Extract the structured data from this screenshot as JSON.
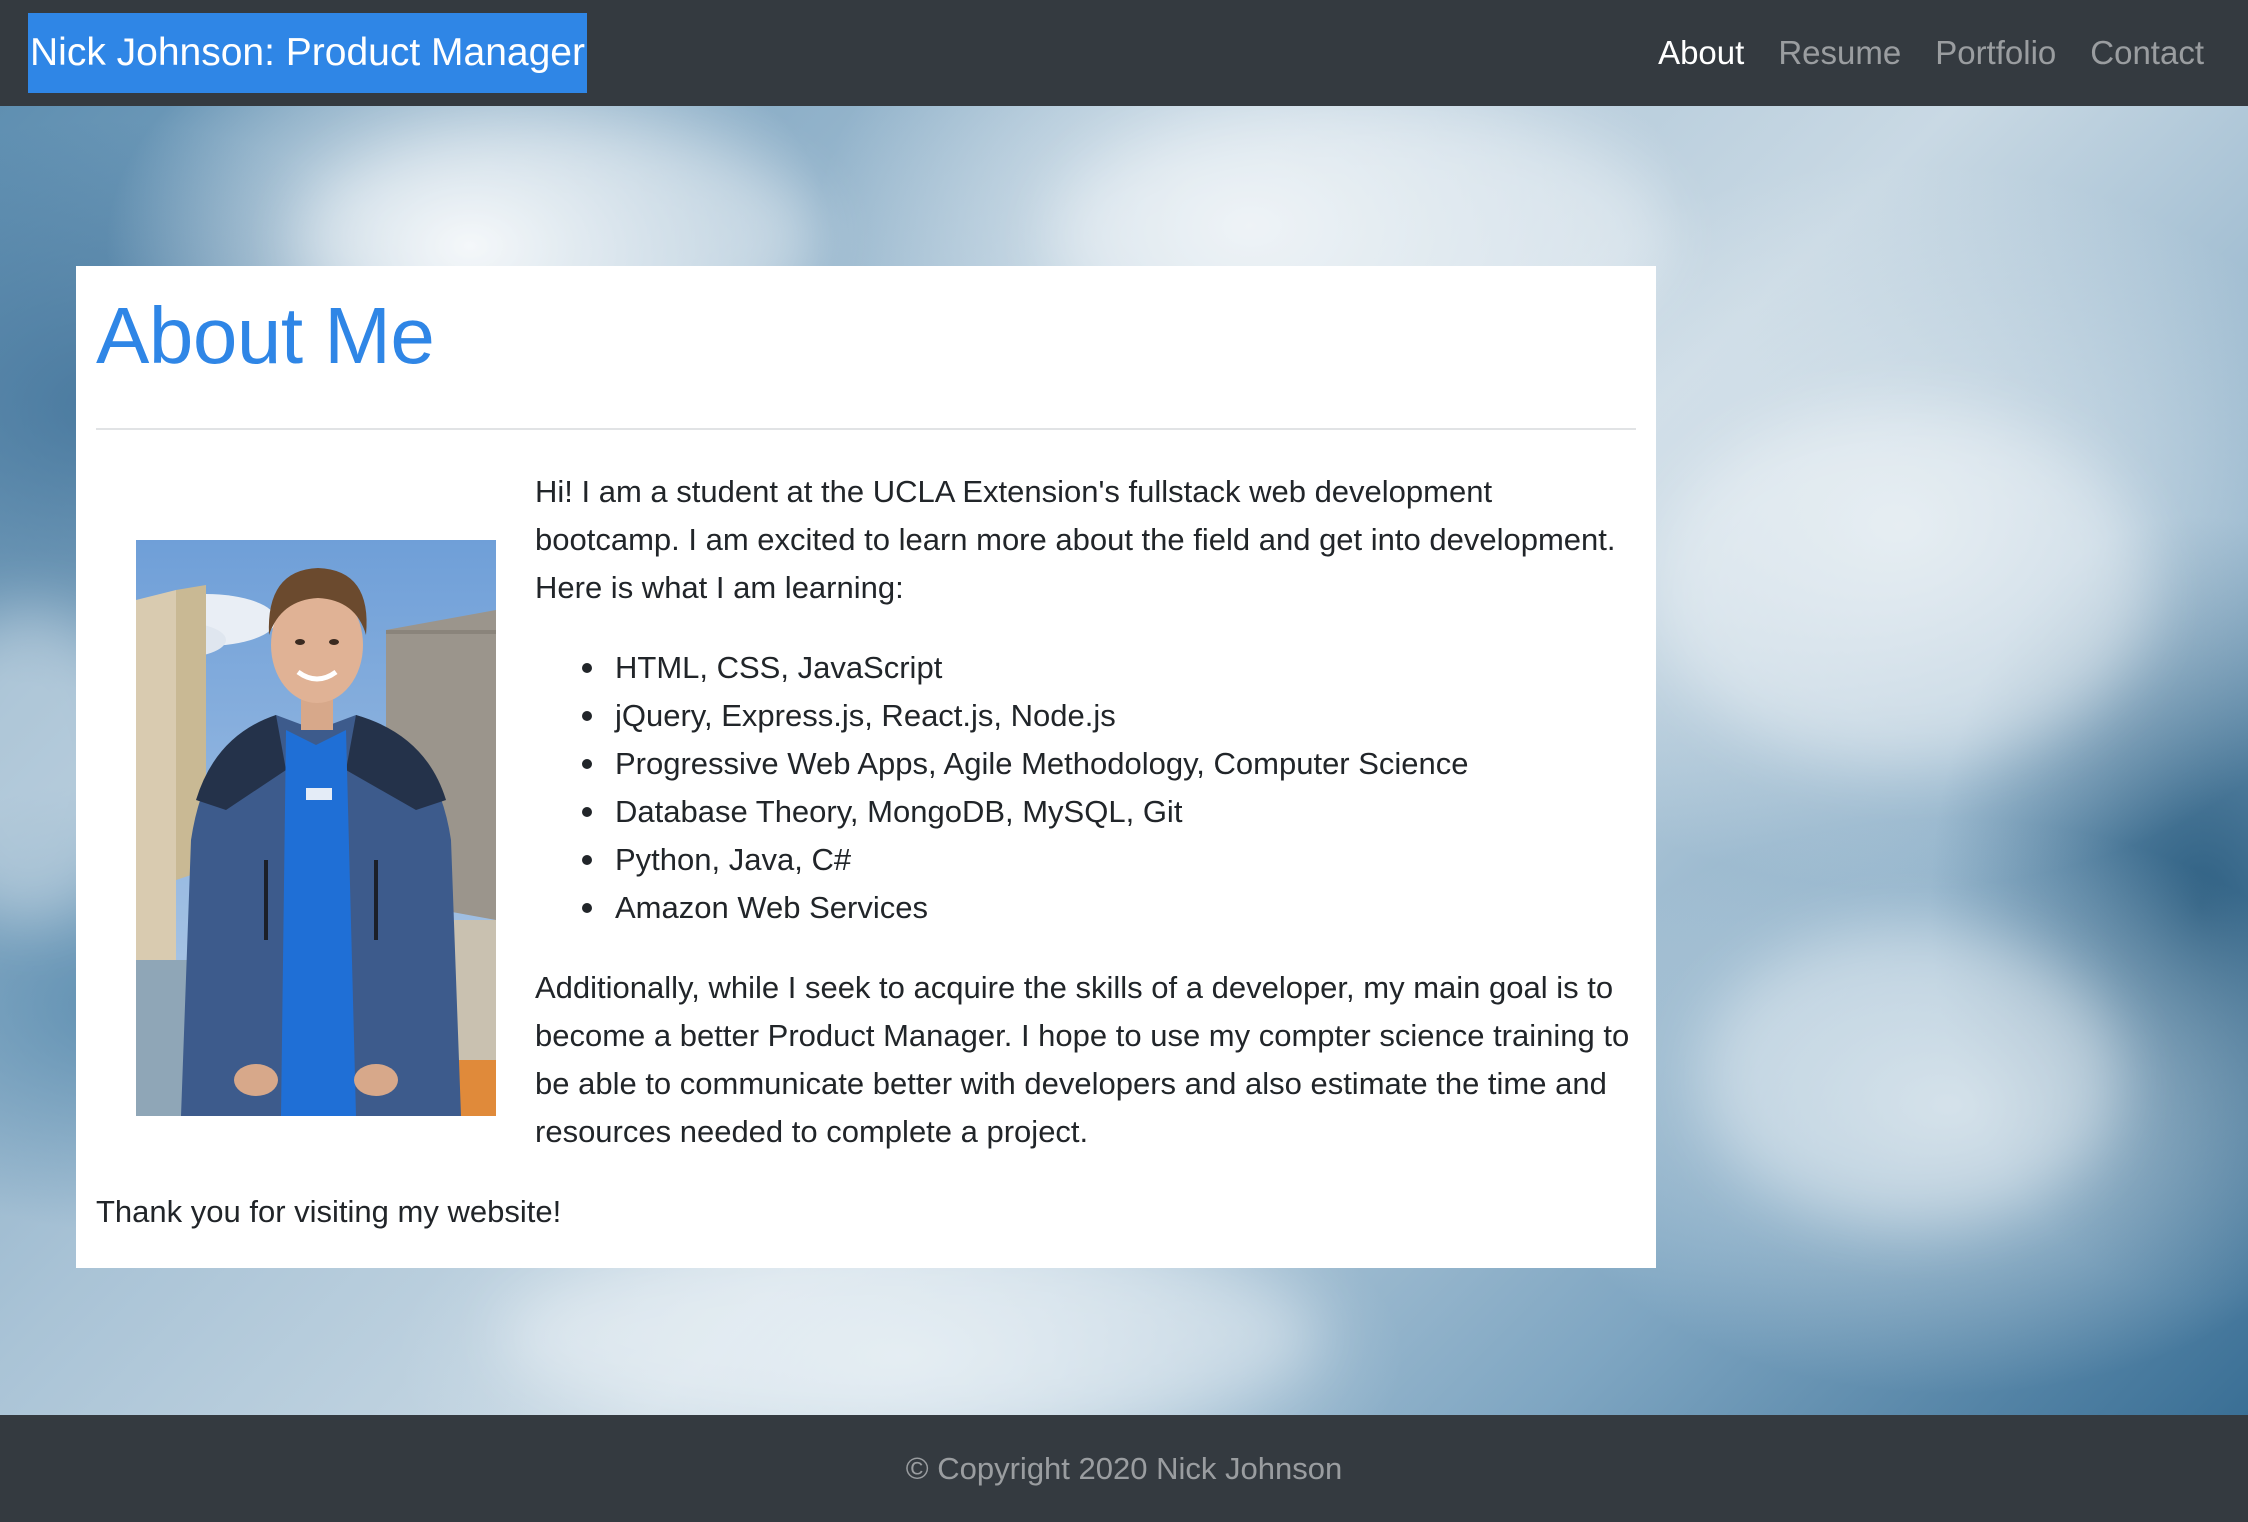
{
  "navbar": {
    "brand": "Nick Johnson: Product Manager",
    "links": [
      {
        "label": "About",
        "active": true
      },
      {
        "label": "Resume",
        "active": false
      },
      {
        "label": "Portfolio",
        "active": false
      },
      {
        "label": "Contact",
        "active": false
      }
    ]
  },
  "about": {
    "title": "About Me",
    "photo_alt": "Nick Johnson",
    "intro": "Hi! I am a student at the UCLA Extension's fullstack web development bootcamp. I am excited to learn more about the field and get into development. Here is what I am learning:",
    "skills": [
      "HTML, CSS, JavaScript",
      "jQuery, Express.js, React.js, Node.js",
      "Progressive Web Apps, Agile Methodology, Computer Science",
      "Database Theory, MongoDB, MySQL, Git",
      "Python, Java, C#",
      "Amazon Web Services"
    ],
    "goal": "Additionally, while I seek to acquire the skills of a developer, my main goal is to become a better Product Manager. I hope to use my compter science training to be able to communicate better with developers and also estimate the time and resources needed to complete a project.",
    "thanks": "Thank you for visiting my website!"
  },
  "footer": {
    "copyright": "© Copyright 2020 Nick Johnson"
  },
  "colors": {
    "navbar_bg": "#343a40",
    "brand_bg": "#2f86e6",
    "title": "#2f86e6",
    "text": "#212529"
  }
}
